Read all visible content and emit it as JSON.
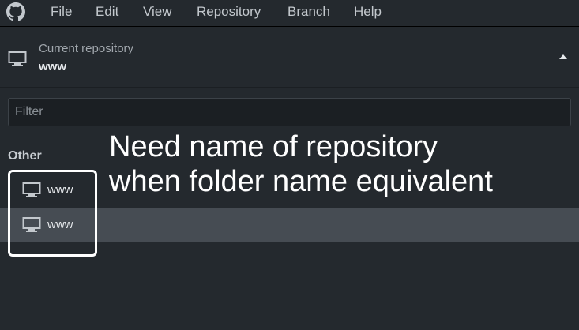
{
  "menubar": {
    "logo_icon": "github-octocat-icon",
    "items": [
      {
        "label": "File"
      },
      {
        "label": "Edit"
      },
      {
        "label": "View"
      },
      {
        "label": "Repository"
      },
      {
        "label": "Branch"
      },
      {
        "label": "Help"
      }
    ]
  },
  "current_repository": {
    "icon": "monitor-icon",
    "caption": "Current repository",
    "name": "www",
    "toggle_icon": "caret-up-icon"
  },
  "filter": {
    "placeholder": "Filter",
    "value": ""
  },
  "repository_list": {
    "section_label": "Other",
    "items": [
      {
        "label": "www",
        "icon": "monitor-icon",
        "selected": false
      },
      {
        "label": "www",
        "icon": "monitor-icon",
        "selected": true
      }
    ]
  },
  "annotation": {
    "line1": "Need name of repository",
    "line2": "when folder name equivalent"
  },
  "colors": {
    "background": "#24292e",
    "selected_row": "#464c53",
    "annotation": "#ffffff"
  }
}
